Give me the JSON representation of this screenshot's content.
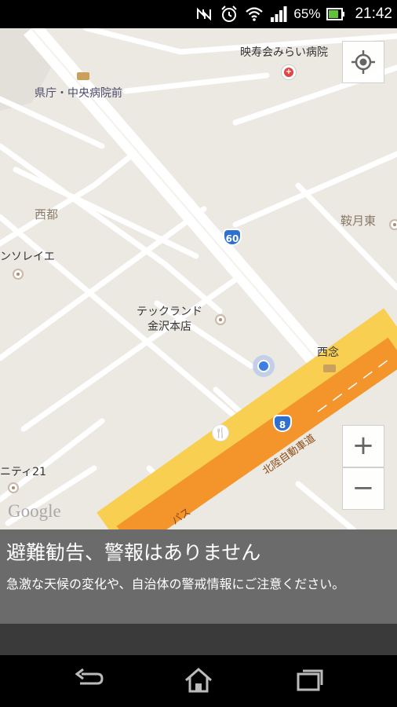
{
  "status_bar": {
    "icons": [
      "nfc-icon",
      "alarm-icon",
      "wifi-icon",
      "signal-icon",
      "battery-icon"
    ],
    "battery_pct": "65%",
    "time": "21:42"
  },
  "map": {
    "labels": {
      "hospital": "映寿会みらい病院",
      "bus_stop": "県庁・中央病院前",
      "district_nishito": "西都",
      "district_kurazuki": "鞍月東",
      "store_sorei": "ンソレイエ",
      "store_techland": "テックランド\n金沢本店",
      "area_nishinen": "西念",
      "store_nity": "ニティ21",
      "expressway": "北陸自動車道",
      "bypass_fragment": "パス"
    },
    "route_shields": {
      "route60": "60",
      "route8": "8"
    },
    "google_logo": "Google",
    "controls": {
      "zoom_in": "+",
      "zoom_out": "−"
    }
  },
  "alert": {
    "title": "避難勧告、警報はありません",
    "message": "急激な天候の変化や、自治体の警戒情報にご注意ください。"
  },
  "nav_bar": {
    "buttons": [
      "back-icon",
      "home-icon",
      "recent-apps-icon"
    ]
  },
  "colors": {
    "map_bg": "#ece9e3",
    "road": "#ffffff",
    "expressway": "#f7a234",
    "alert_bg": "#6b6b6b",
    "route_shield": "#2f6fd0"
  }
}
